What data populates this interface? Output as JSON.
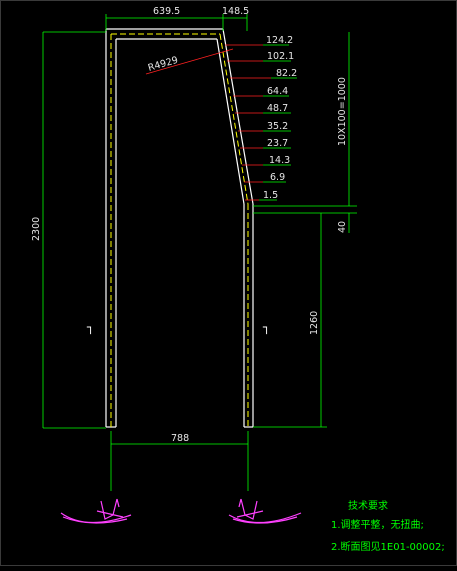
{
  "colors": {
    "background": "#000000",
    "dimension_line": "#00ff00",
    "leader_line": "#ff2020",
    "outline": "#ffffff",
    "inner_line": "#ffff00",
    "profile": "#ff40ff",
    "text": "#e6e6e6"
  },
  "top_dimensions": {
    "width_left": "639.5",
    "width_right": "148.5"
  },
  "radius_label": "R4929",
  "offsets": [
    "124.2",
    "102.1",
    "82.2",
    "64.4",
    "48.7",
    "35.2",
    "23.7",
    "14.3",
    "6.9",
    "1.5"
  ],
  "side_dimensions": {
    "total_height": "2300",
    "pitch": "10X100=1000",
    "gap": "40",
    "lower_height": "1260"
  },
  "bottom_dimension": "788",
  "section_marks": {
    "left": "┐",
    "right": "┐"
  },
  "notes": {
    "title": "技术要求",
    "line1": "1.调整平整，无扭曲;",
    "line2": "2.断面图见1E01-00002;"
  }
}
